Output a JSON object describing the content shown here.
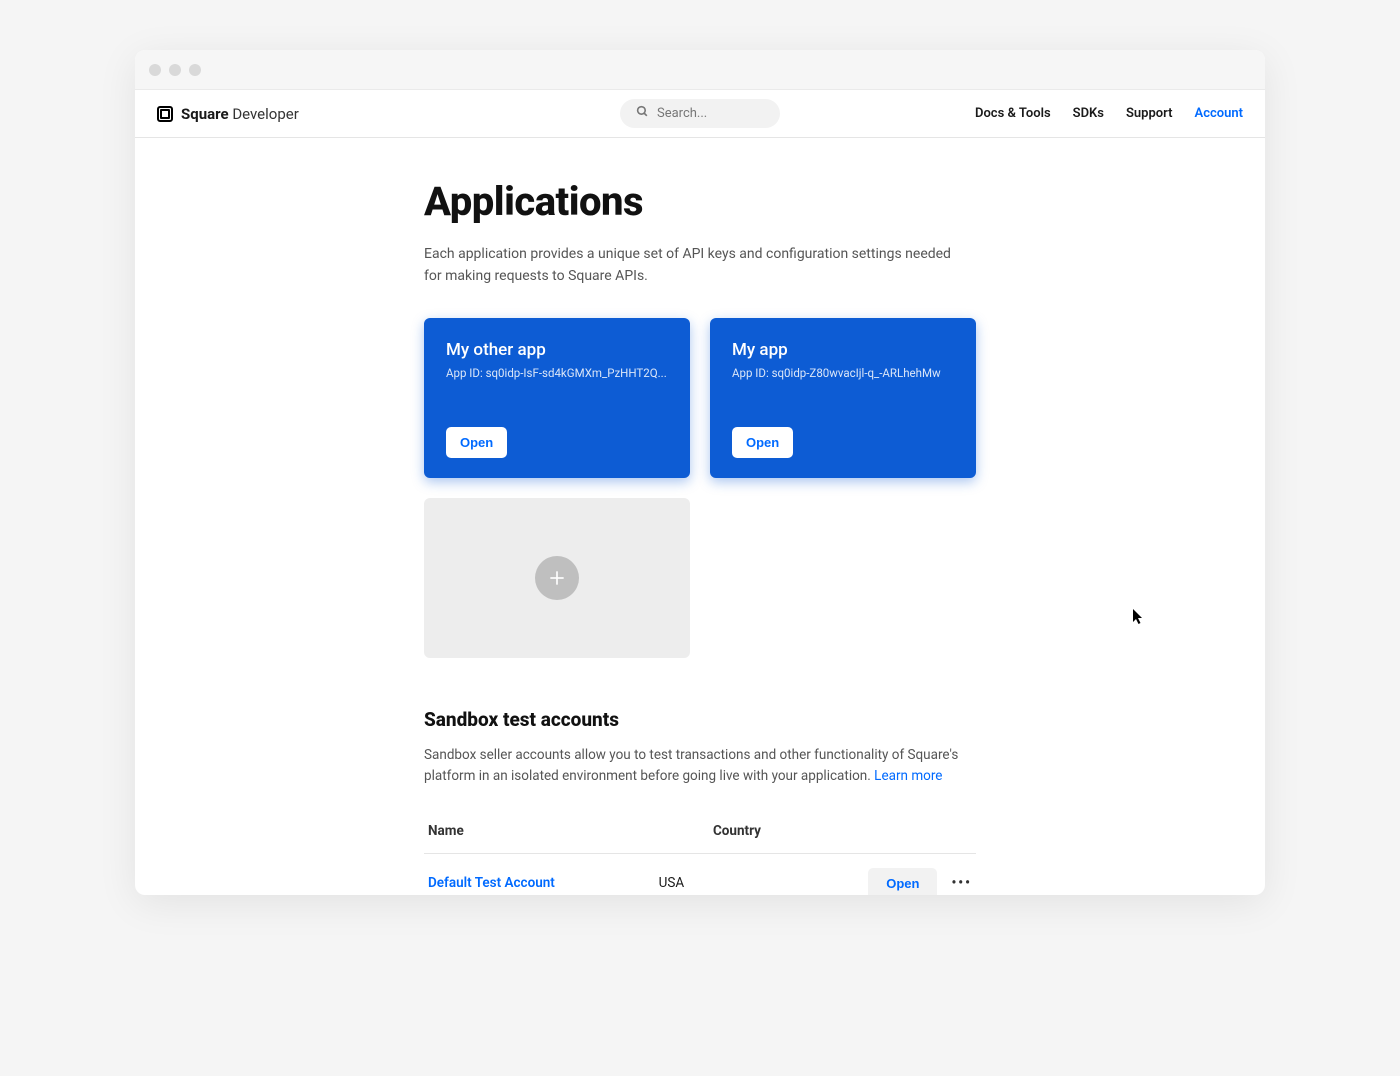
{
  "brand": {
    "word1": "Square",
    "word2": "Developer"
  },
  "search": {
    "placeholder": "Search..."
  },
  "nav": {
    "items": [
      "Docs & Tools",
      "SDKs",
      "Support",
      "Account"
    ],
    "active": "Account"
  },
  "page": {
    "title": "Applications",
    "description": "Each application provides a unique set of API keys and configuration settings needed for making requests to Square APIs."
  },
  "apps": [
    {
      "name": "My other app",
      "app_id_label": "App ID: sq0idp-IsF-sd4kGMXm_PzHHT2Q...",
      "open_label": "Open"
    },
    {
      "name": "My app",
      "app_id_label": "App ID: sq0idp-Z80wvacIjl-q_-ARLhehMw",
      "open_label": "Open"
    }
  ],
  "sandbox": {
    "heading": "Sandbox test accounts",
    "description": "Sandbox seller accounts allow you to test transactions and other functionality of Square's platform in an isolated environment before going live with your application. ",
    "learn_more": "Learn more",
    "columns": {
      "name": "Name",
      "country": "Country"
    },
    "rows": [
      {
        "name": "Default Test Account",
        "country": "USA",
        "open_label": "Open"
      }
    ]
  }
}
